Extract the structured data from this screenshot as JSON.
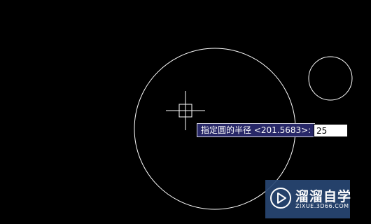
{
  "canvas": {
    "background": "#000000",
    "stroke_color": "#ffffff"
  },
  "prompt": {
    "label": "指定圆的半径 <201.5683>:",
    "value": "25"
  },
  "cursor": {
    "icon": "crosshair-pickbox-icon"
  },
  "watermark": {
    "icon": "play-logo-icon",
    "title": "溜溜自学",
    "url": "ZIXUE.3D66.COM"
  }
}
